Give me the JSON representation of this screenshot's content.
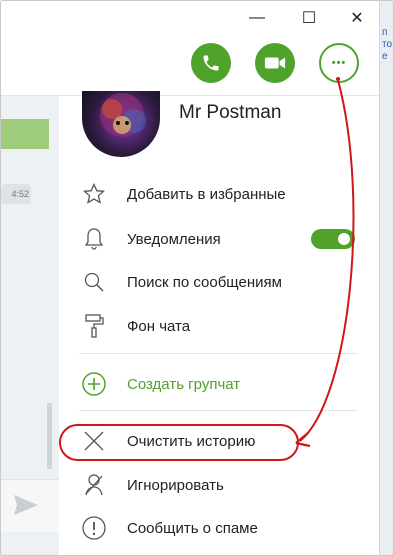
{
  "window": {
    "controls": {
      "minimize": "—",
      "maximize": "☐",
      "close": "✕"
    },
    "side_strip_text": "п\nто\nе"
  },
  "header": {
    "call_icon": "phone-icon",
    "video_icon": "video-camera-icon",
    "more_label": "•••"
  },
  "chat": {
    "timestamp": "4:52"
  },
  "contact": {
    "name": "Mr Postman"
  },
  "menu": {
    "items": [
      {
        "label": "Добавить в избранные",
        "icon": "star-icon"
      },
      {
        "label": "Уведомления",
        "icon": "bell-icon"
      },
      {
        "label": "Поиск по сообщениям",
        "icon": "search-icon"
      },
      {
        "label": "Фон чата",
        "icon": "paint-roller-icon"
      },
      {
        "label": "Создать групчат",
        "icon": "plus-circle-icon"
      },
      {
        "label": "Очистить историю",
        "icon": "close-icon"
      },
      {
        "label": "Игнорировать",
        "icon": "ignore-icon"
      },
      {
        "label": "Сообщить о спаме",
        "icon": "alert-icon"
      }
    ],
    "notifications_enabled": true
  },
  "colors": {
    "accent": "#4fa32a",
    "annotation": "#d0161b"
  }
}
